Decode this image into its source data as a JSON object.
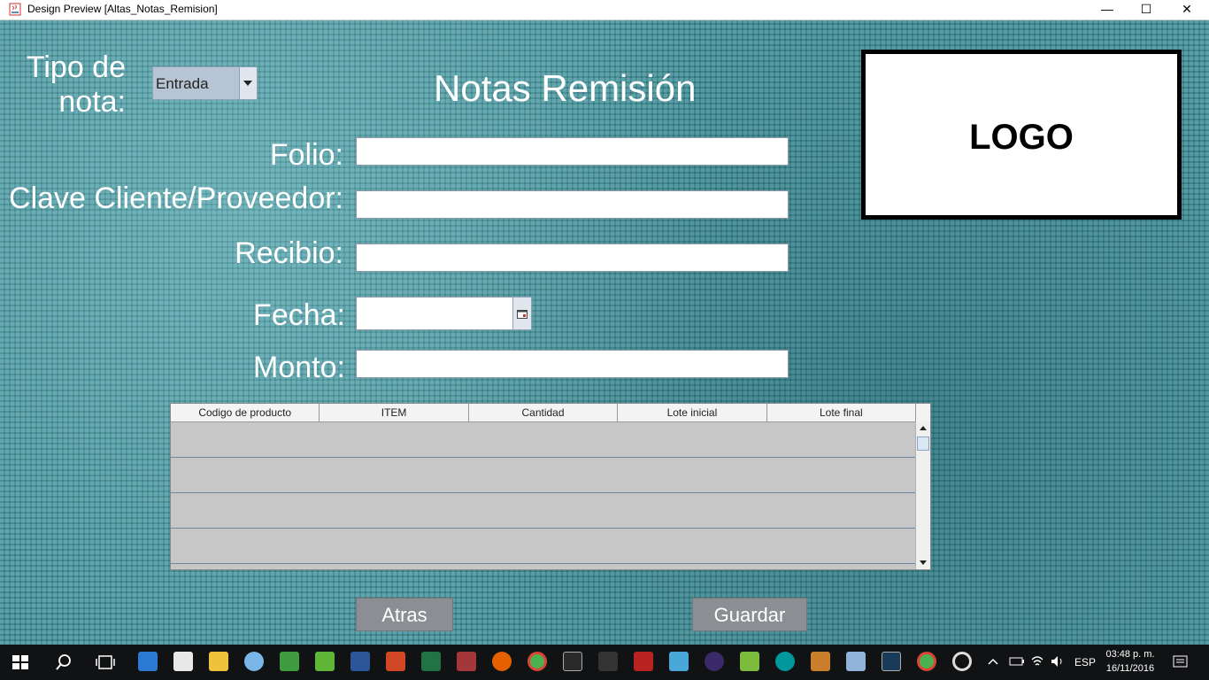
{
  "window": {
    "title": "Design Preview [Altas_Notas_Remision]",
    "minimize_label": "—",
    "maximize_label": "☐",
    "close_label": "✕"
  },
  "form": {
    "tipo_label": "Tipo de nota:",
    "tipo_value": "Entrada",
    "heading": "Notas Remisión",
    "folio_label": "Folio:",
    "clave_label": "Clave Cliente/Proveedor:",
    "recibio_label": "Recibio:",
    "fecha_label": "Fecha:",
    "monto_label": "Monto:",
    "folio_value": "",
    "clave_value": "",
    "recibio_value": "",
    "fecha_value": "",
    "monto_value": ""
  },
  "logo": {
    "text": "LOGO"
  },
  "table": {
    "columns": [
      "Codigo de producto",
      "ITEM",
      "Cantidad",
      "Lote inicial",
      "Lote final"
    ]
  },
  "buttons": {
    "back_label": "Atras",
    "save_label": "Guardar"
  },
  "taskbar": {
    "language": "ESP",
    "time": "03:48 p. m.",
    "date": "16/11/2016",
    "apps": [
      "start-icon",
      "search-icon",
      "task-view-icon",
      "photos-icon",
      "camera-icon",
      "file-explorer-icon",
      "browser-icon",
      "camtasia-icon",
      "camtasia-recorder-icon",
      "word-icon",
      "powerpoint-icon",
      "excel-icon",
      "access-icon",
      "firefox-icon",
      "chrome-icon",
      "terminal-icon",
      "game-icon",
      "dota-icon",
      "app-icon",
      "eclipse-icon",
      "notepad-icon",
      "arduino-icon",
      "paint-icon",
      "netbeans-icon",
      "mysql-icon",
      "chrome-icon-2",
      "media-icon"
    ]
  },
  "colors": {
    "background": "#3d8f98",
    "taskbar": "#101214",
    "button": "#8b8f94"
  }
}
